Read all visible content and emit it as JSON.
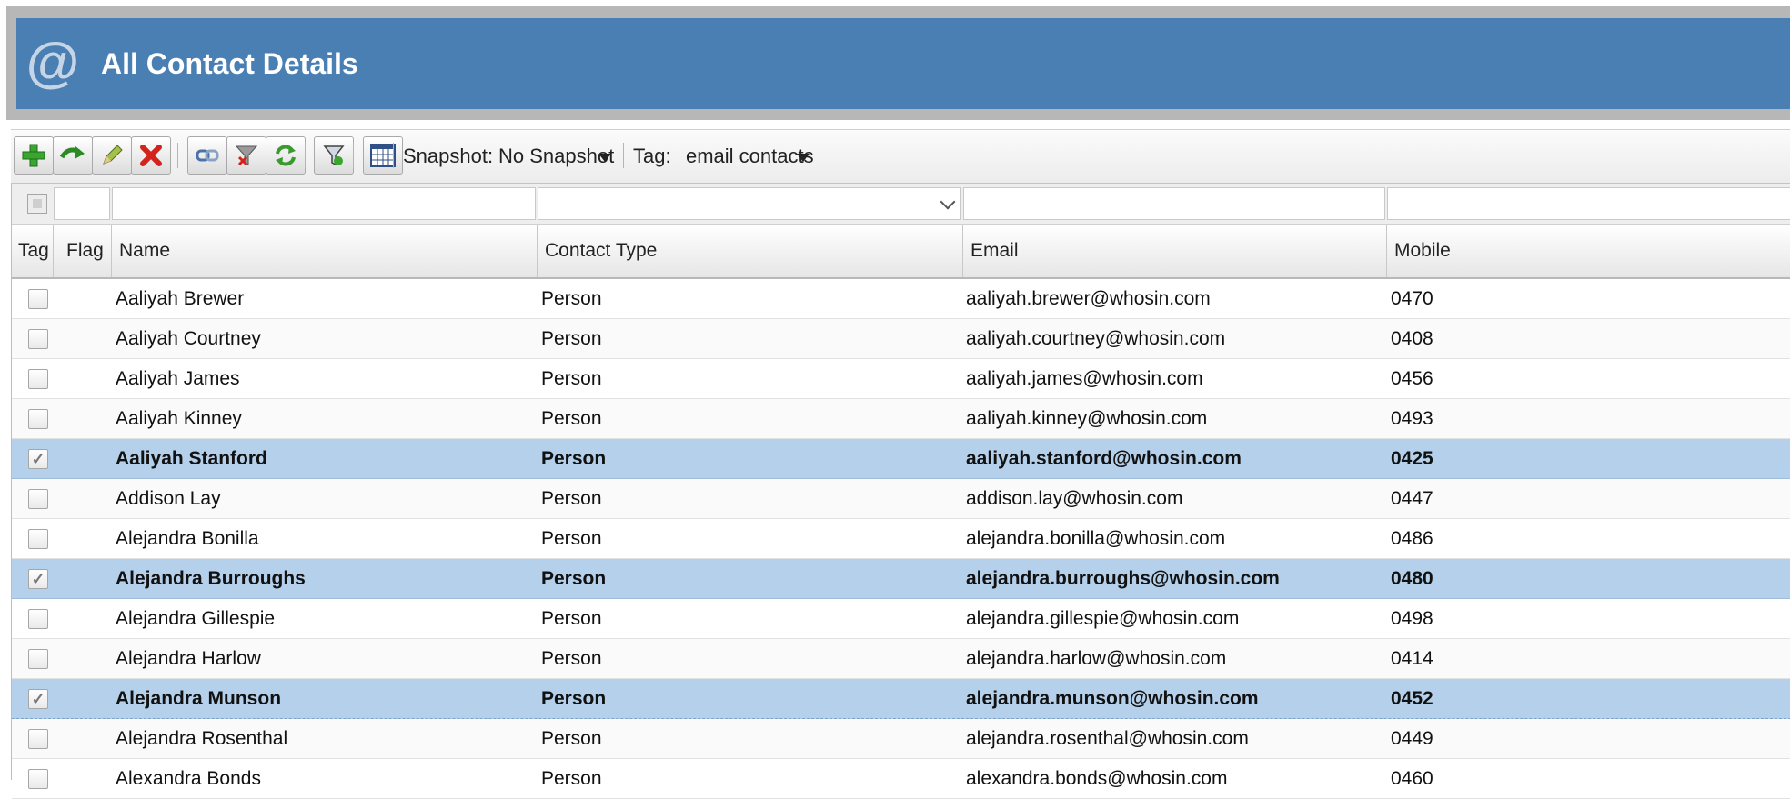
{
  "app": {
    "title": "All Contact Details",
    "icon": "at-sign-icon",
    "accent_color": "#4a7fb4"
  },
  "toolbar": {
    "buttons": [
      {
        "name": "add-button",
        "icon": "plus-icon"
      },
      {
        "name": "forward-button",
        "icon": "green-arrow-icon"
      },
      {
        "name": "edit-button",
        "icon": "pencil-icon"
      },
      {
        "name": "delete-button",
        "icon": "red-x-icon"
      },
      {
        "name": "link-button",
        "icon": "chain-link-icon"
      },
      {
        "name": "clear-filter-button",
        "icon": "filter-remove-icon"
      },
      {
        "name": "refresh-button",
        "icon": "refresh-icon"
      },
      {
        "name": "export-button",
        "icon": "export-funnel-icon"
      },
      {
        "name": "calendar-button",
        "icon": "calendar-grid-icon"
      }
    ],
    "snapshot_label": "Snapshot:",
    "snapshot_value": "No Snapshot",
    "tag_label": "Tag:",
    "tag_value": "email contacts"
  },
  "grid": {
    "columns": [
      "Tag",
      "Flag",
      "Name",
      "Contact Type",
      "Email",
      "Mobile"
    ],
    "rows": [
      {
        "checked": false,
        "selected": false,
        "name": "Aaliyah Brewer",
        "type": "Person",
        "email": "aaliyah.brewer@whosin.com",
        "mobile": "0470"
      },
      {
        "checked": false,
        "selected": false,
        "name": "Aaliyah Courtney",
        "type": "Person",
        "email": "aaliyah.courtney@whosin.com",
        "mobile": "0408"
      },
      {
        "checked": false,
        "selected": false,
        "name": "Aaliyah James",
        "type": "Person",
        "email": "aaliyah.james@whosin.com",
        "mobile": "0456"
      },
      {
        "checked": false,
        "selected": false,
        "name": "Aaliyah Kinney",
        "type": "Person",
        "email": "aaliyah.kinney@whosin.com",
        "mobile": "0493"
      },
      {
        "checked": true,
        "selected": true,
        "name": "Aaliyah Stanford",
        "type": "Person",
        "email": "aaliyah.stanford@whosin.com",
        "mobile": "0425"
      },
      {
        "checked": false,
        "selected": false,
        "name": "Addison Lay",
        "type": "Person",
        "email": "addison.lay@whosin.com",
        "mobile": "0447"
      },
      {
        "checked": false,
        "selected": false,
        "name": "Alejandra Bonilla",
        "type": "Person",
        "email": "alejandra.bonilla@whosin.com",
        "mobile": "0486"
      },
      {
        "checked": true,
        "selected": true,
        "name": "Alejandra Burroughs",
        "type": "Person",
        "email": "alejandra.burroughs@whosin.com",
        "mobile": "0480"
      },
      {
        "checked": false,
        "selected": false,
        "name": "Alejandra Gillespie",
        "type": "Person",
        "email": "alejandra.gillespie@whosin.com",
        "mobile": "0498"
      },
      {
        "checked": false,
        "selected": false,
        "name": "Alejandra Harlow",
        "type": "Person",
        "email": "alejandra.harlow@whosin.com",
        "mobile": "0414"
      },
      {
        "checked": true,
        "selected": true,
        "name": "Alejandra Munson",
        "type": "Person",
        "email": "alejandra.munson@whosin.com",
        "mobile": "0452"
      },
      {
        "checked": false,
        "selected": false,
        "name": "Alejandra Rosenthal",
        "type": "Person",
        "email": "alejandra.rosenthal@whosin.com",
        "mobile": "0449"
      },
      {
        "checked": false,
        "selected": false,
        "name": "Alexandra Bonds",
        "type": "Person",
        "email": "alexandra.bonds@whosin.com",
        "mobile": "0460"
      }
    ]
  }
}
